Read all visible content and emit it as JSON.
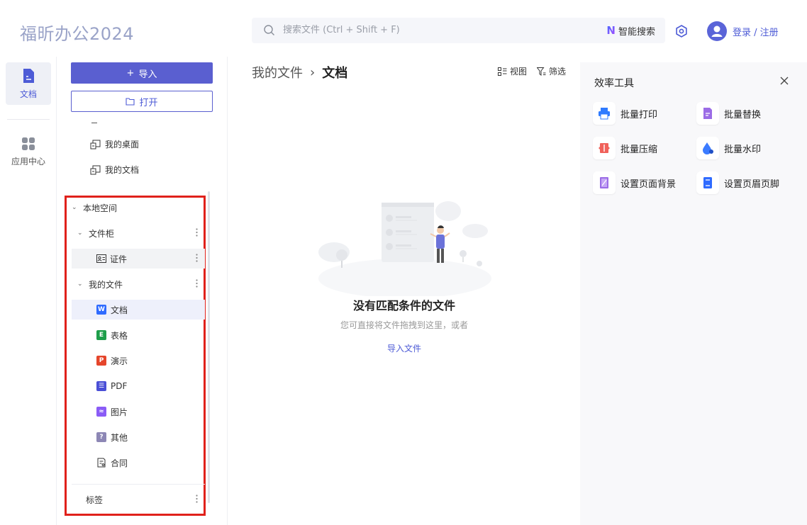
{
  "header": {
    "app_title": "福昕办公2024",
    "search_placeholder": "搜索文件 (Ctrl + Shift + F)",
    "ai_search_label": "智能搜索",
    "login_label": "登录 / 注册"
  },
  "rail": {
    "items": [
      {
        "label": "文档",
        "active": true
      },
      {
        "label": "应用中心",
        "active": false
      }
    ]
  },
  "files": {
    "import_label": "导入",
    "open_label": "打开",
    "quick": [
      {
        "label": "我的桌面"
      },
      {
        "label": "我的文档"
      }
    ],
    "tree": {
      "local_space": "本地空间",
      "cabinet": "文件柜",
      "certificate": "证件",
      "my_files": "我的文件",
      "types": [
        {
          "label": "文档",
          "color": "#2f6bff",
          "glyph": "W"
        },
        {
          "label": "表格",
          "color": "#1e9e4a",
          "glyph": "E"
        },
        {
          "label": "演示",
          "color": "#e5452b",
          "glyph": "P"
        },
        {
          "label": "PDF",
          "color": "#4a4fd6",
          "glyph": "☰"
        },
        {
          "label": "图片",
          "color": "#8a5cf6",
          "glyph": "≈"
        },
        {
          "label": "其他",
          "color": "#8d87b5",
          "glyph": "?"
        },
        {
          "label": "合同",
          "color": "#ffffff",
          "glyph": ""
        }
      ],
      "tags": "标签"
    }
  },
  "main": {
    "breadcrumb": {
      "root": "我的文件",
      "separator": "›",
      "current": "文档"
    },
    "view_label": "视图",
    "filter_label": "筛选",
    "empty": {
      "title": "没有匹配条件的文件",
      "subtitle": "您可直接将文件拖拽到这里，或者",
      "link": "导入文件"
    }
  },
  "panel": {
    "title": "效率工具",
    "tools": [
      {
        "label": "批量打印",
        "icon": "printer-icon",
        "color": "#2f7bff"
      },
      {
        "label": "批量替换",
        "icon": "replace-doc-icon",
        "color": "#9b6ce6"
      },
      {
        "label": "批量压缩",
        "icon": "compress-icon",
        "color": "#f0615a"
      },
      {
        "label": "批量水印",
        "icon": "watermark-icon",
        "color": "#3b7bff"
      },
      {
        "label": "设置页面背景",
        "icon": "page-background-icon",
        "color": "#9b6ce6"
      },
      {
        "label": "设置页眉页脚",
        "icon": "header-footer-icon",
        "color": "#2f6bff"
      }
    ]
  }
}
